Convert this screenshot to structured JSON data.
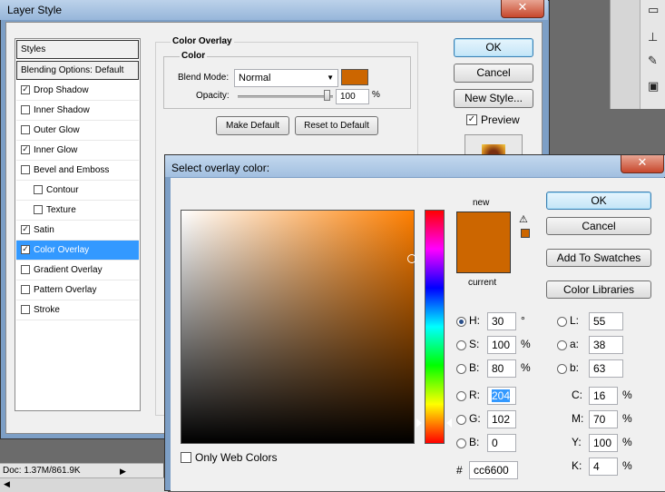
{
  "colors": {
    "accent_select": "#3399ff",
    "overlay_color": "#cc6600",
    "hex_highlight": "#3399ff"
  },
  "background": {
    "status_doc": "Doc: 1.37M/861.9K"
  },
  "layer_style": {
    "title": "Layer Style",
    "styles_header": "Styles",
    "blending_header": "Blending Options: Default",
    "items": [
      {
        "label": "Drop Shadow",
        "checked": "✓"
      },
      {
        "label": "Inner Shadow",
        "checked": ""
      },
      {
        "label": "Outer Glow",
        "checked": ""
      },
      {
        "label": "Inner Glow",
        "checked": "✓"
      },
      {
        "label": "Bevel and Emboss",
        "checked": ""
      },
      {
        "label": "Contour",
        "checked": ""
      },
      {
        "label": "Texture",
        "checked": ""
      },
      {
        "label": "Satin",
        "checked": "✓"
      },
      {
        "label": "Color Overlay",
        "checked": "✓"
      },
      {
        "label": "Gradient Overlay",
        "checked": ""
      },
      {
        "label": "Pattern Overlay",
        "checked": ""
      },
      {
        "label": "Stroke",
        "checked": ""
      }
    ],
    "overlay": {
      "group_title": "Color Overlay",
      "sub_title": "Color",
      "blend_mode_label": "Blend Mode:",
      "blend_mode_value": "Normal",
      "opacity_label": "Opacity:",
      "opacity_value": "100",
      "opacity_unit": "%",
      "make_default": "Make Default",
      "reset_default": "Reset to Default"
    },
    "ok": "OK",
    "cancel": "Cancel",
    "new_style": "New Style...",
    "preview_label": "Preview",
    "preview_checked": "✓"
  },
  "picker": {
    "title": "Select overlay color:",
    "new_label": "new",
    "current_label": "current",
    "ok": "OK",
    "cancel": "Cancel",
    "add_swatches": "Add To Swatches",
    "color_libraries": "Color Libraries",
    "only_web": "Only Web Colors",
    "hsb": [
      {
        "label": "H:",
        "value": "30",
        "unit": "°"
      },
      {
        "label": "S:",
        "value": "100",
        "unit": "%"
      },
      {
        "label": "B:",
        "value": "80",
        "unit": "%"
      }
    ],
    "rgb": [
      {
        "label": "R:",
        "value": "204"
      },
      {
        "label": "G:",
        "value": "102"
      },
      {
        "label": "B:",
        "value": "0"
      }
    ],
    "lab": [
      {
        "label": "L:",
        "value": "55"
      },
      {
        "label": "a:",
        "value": "38"
      },
      {
        "label": "b:",
        "value": "63"
      }
    ],
    "cmyk": [
      {
        "label": "C:",
        "value": "16",
        "unit": "%"
      },
      {
        "label": "M:",
        "value": "70",
        "unit": "%"
      },
      {
        "label": "Y:",
        "value": "100",
        "unit": "%"
      },
      {
        "label": "K:",
        "value": "4",
        "unit": "%"
      }
    ],
    "hex_label": "#",
    "hex_value": "cc6600"
  }
}
